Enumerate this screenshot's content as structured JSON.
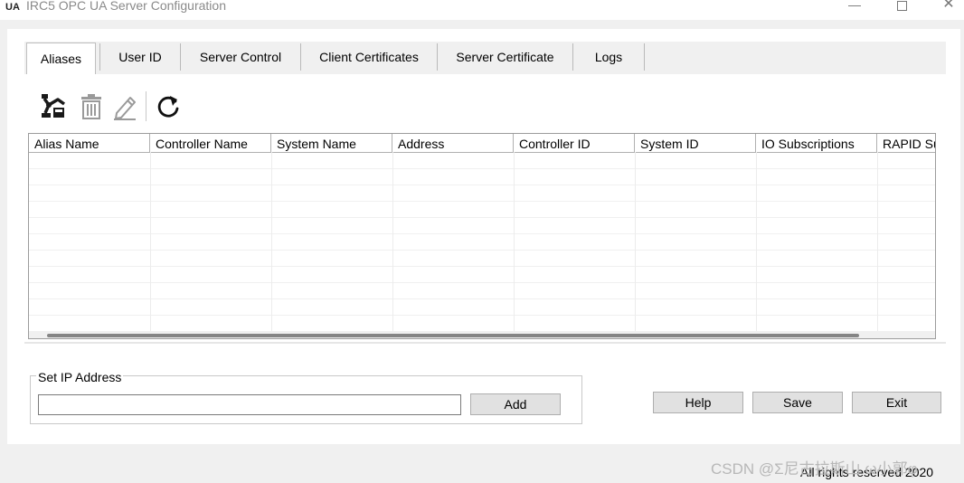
{
  "window": {
    "icon_text": "UA",
    "title": "IRC5 OPC UA Server Configuration",
    "minimize": "—",
    "close": "✕"
  },
  "tabs": [
    {
      "label": "Aliases",
      "active": true
    },
    {
      "label": "User ID"
    },
    {
      "label": "Server Control"
    },
    {
      "label": "Client Certificates"
    },
    {
      "label": "Server Certificate"
    },
    {
      "label": "Logs"
    }
  ],
  "toolbar": {
    "icons": [
      "add-controller-icon",
      "delete-trash-icon",
      "edit-pencil-icon",
      "refresh-icon"
    ]
  },
  "table": {
    "columns": [
      "Alias Name",
      "Controller Name",
      "System Name",
      "Address",
      "Controller ID",
      "System ID",
      "IO Subscriptions",
      "RAPID Su"
    ],
    "rows": []
  },
  "ip_group": {
    "label": "Set IP Address",
    "value": "",
    "add_label": "Add"
  },
  "actions": {
    "help_label": "Help",
    "save_label": "Save",
    "exit_label": "Exit"
  },
  "watermark": "CSDN @Σ尼古拉斯山    ω小郭φ",
  "footer": "All rights reserved 2020"
}
